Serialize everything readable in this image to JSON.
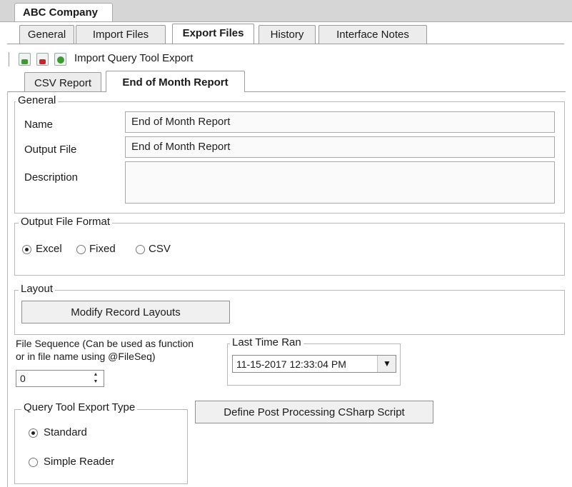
{
  "company_tab": "ABC Company",
  "tabs": [
    {
      "label": "General"
    },
    {
      "label": "Import Files"
    },
    {
      "label": "Export Files"
    },
    {
      "label": "History"
    },
    {
      "label": "Interface Notes"
    }
  ],
  "toolbar": {
    "icons": [
      "add-export-icon",
      "delete-export-icon",
      "import-query-icon"
    ],
    "import_label": "Import Query Tool Export"
  },
  "subtabs": [
    {
      "label": "CSV Report"
    },
    {
      "label": "End of Month Report"
    }
  ],
  "general": {
    "title": "General",
    "name_label": "Name",
    "name_value": "End of Month Report",
    "output_label": "Output File",
    "output_value": "End of Month Report",
    "description_label": "Description",
    "description_value": ""
  },
  "output_format": {
    "title": "Output File Format",
    "options": [
      "Excel",
      "Fixed",
      "CSV"
    ],
    "selected": "Excel"
  },
  "layout": {
    "title": "Layout",
    "button": "Modify Record Layouts"
  },
  "file_sequence": {
    "label_line1": "File Sequence (Can be used as function",
    "label_line2": "or in file name using @FileSeq)",
    "value": "0"
  },
  "last_time_ran": {
    "title": "Last Time Ran",
    "value": "11-15-2017 12:33:04 PM"
  },
  "query_export_type": {
    "title": "Query Tool Export Type",
    "options": [
      "Standard",
      "Simple Reader"
    ],
    "selected": "Standard"
  },
  "post_processing_button": "Define Post Processing CSharp Script"
}
